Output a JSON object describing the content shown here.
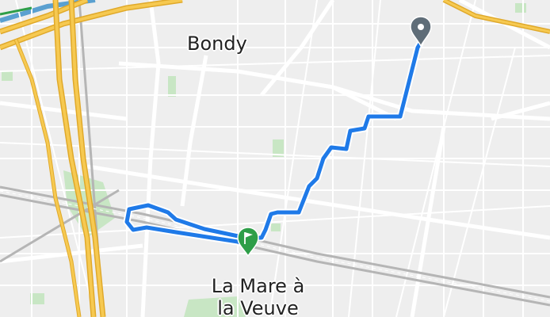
{
  "map": {
    "place_labels": {
      "bondy": "Bondy",
      "mare_line1": "La Mare à",
      "mare_line2": "la Veuve"
    },
    "route": {
      "color": "#1f7ae8",
      "start_marker_color": "#5f6d78",
      "end_marker_color": "#2e9e48",
      "end_marker_icon": "flag-icon"
    },
    "colors": {
      "background": "#f2f2f2",
      "road": "#ffffff",
      "highway": "#f3c24a",
      "park": "#c8e6c4",
      "rail": "#b8b8b8",
      "water": "#5aa0d0"
    }
  }
}
